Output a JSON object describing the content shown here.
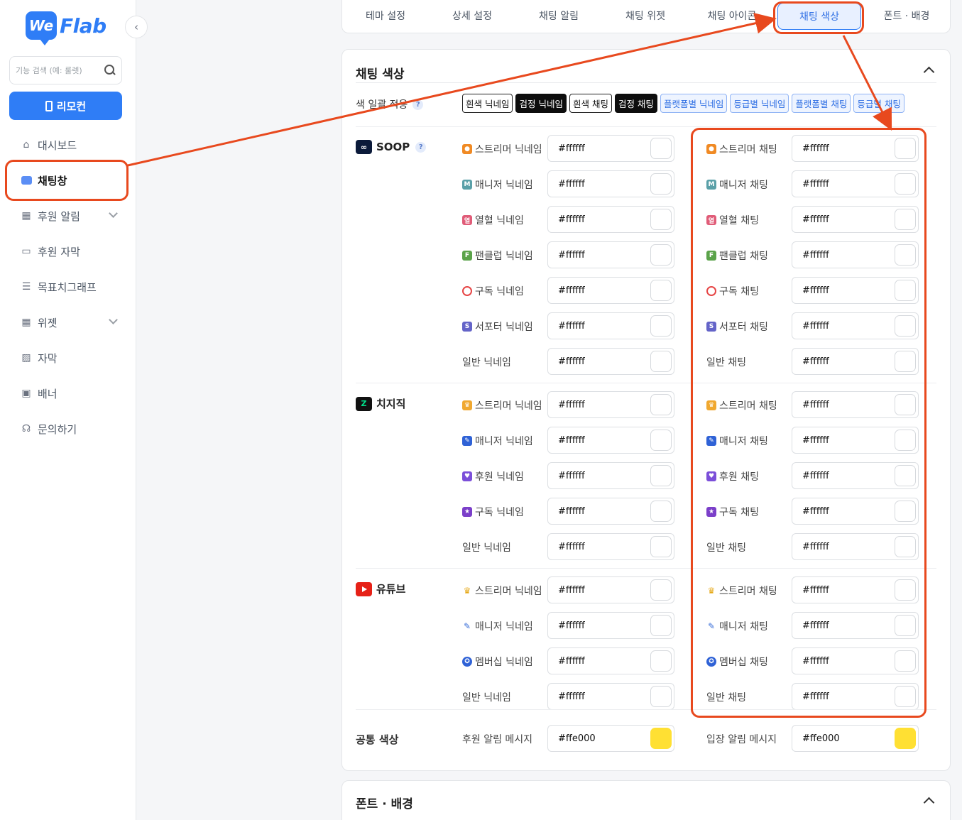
{
  "app": {
    "logo_badge": "We",
    "logo_text": "Flab"
  },
  "sidebar": {
    "search_placeholder": "기능 검색 (예: 룰렛)",
    "remote_label": "리모컨",
    "items": [
      {
        "label": "대시보드",
        "icon": "home-icon"
      },
      {
        "label": "채팅창",
        "icon": "chat-icon",
        "active": true
      },
      {
        "label": "후원 알림",
        "icon": "gift-icon",
        "expandable": true
      },
      {
        "label": "후원 자막",
        "icon": "caption-icon"
      },
      {
        "label": "목표치그래프",
        "icon": "graph-icon"
      },
      {
        "label": "위젯",
        "icon": "widget-icon",
        "expandable": true
      },
      {
        "label": "자막",
        "icon": "subtitle-icon"
      },
      {
        "label": "배너",
        "icon": "banner-icon"
      },
      {
        "label": "문의하기",
        "icon": "headset-icon"
      }
    ]
  },
  "tabs": [
    "테마 설정",
    "상세 설정",
    "채팅 알림",
    "채팅 위젯",
    "채팅 아이콘",
    "채팅 색상",
    "폰트 · 배경"
  ],
  "active_tab": "채팅 색상",
  "section": {
    "title": "채팅 색상",
    "bulk_label": "색 일괄 적용",
    "bulk_buttons": [
      {
        "label": "흰색 닉네임",
        "style": "white"
      },
      {
        "label": "검정 닉네임",
        "style": "black"
      },
      {
        "label": "흰색 채팅",
        "style": "white"
      },
      {
        "label": "검정 채팅",
        "style": "black"
      },
      {
        "label": "플랫폼별 닉네임",
        "style": "blue"
      },
      {
        "label": "등급별 닉네임",
        "style": "blue"
      },
      {
        "label": "플랫폼별 채팅",
        "style": "blue"
      },
      {
        "label": "등급별 채팅",
        "style": "blue"
      }
    ],
    "help_glyph": "?",
    "platforms": [
      {
        "name": "SOOP",
        "logo": "soop-logo",
        "help": true,
        "rows": [
          {
            "badge": "mic",
            "nick": "스트리머 닉네임",
            "chat": "스트리머 채팅",
            "nick_value": "#ffffff",
            "chat_value": "#ffffff"
          },
          {
            "badge": "m",
            "nick": "매니저 닉네임",
            "chat": "매니저 채팅",
            "nick_value": "#ffffff",
            "chat_value": "#ffffff"
          },
          {
            "badge": "yeol",
            "nick": "열혈 닉네임",
            "chat": "열혈 채팅",
            "nick_value": "#ffffff",
            "chat_value": "#ffffff"
          },
          {
            "badge": "f",
            "nick": "팬클럽 닉네임",
            "chat": "팬클럽 채팅",
            "nick_value": "#ffffff",
            "chat_value": "#ffffff"
          },
          {
            "badge": "sub",
            "nick": "구독 닉네임",
            "chat": "구독 채팅",
            "nick_value": "#ffffff",
            "chat_value": "#ffffff"
          },
          {
            "badge": "s",
            "nick": "서포터 닉네임",
            "chat": "서포터 채팅",
            "nick_value": "#ffffff",
            "chat_value": "#ffffff"
          },
          {
            "badge": "",
            "nick": "일반 닉네임",
            "chat": "일반 채팅",
            "nick_value": "#ffffff",
            "chat_value": "#ffffff"
          }
        ]
      },
      {
        "name": "치지직",
        "logo": "chzzk-logo",
        "help": false,
        "rows": [
          {
            "badge": "crown",
            "nick": "스트리머 닉네임",
            "chat": "스트리머 채팅",
            "nick_value": "#ffffff",
            "chat_value": "#ffffff"
          },
          {
            "badge": "wrench",
            "nick": "매니저 닉네임",
            "chat": "매니저 채팅",
            "nick_value": "#ffffff",
            "chat_value": "#ffffff"
          },
          {
            "badge": "heart",
            "nick": "후원 닉네임",
            "chat": "후원 채팅",
            "nick_value": "#ffffff",
            "chat_value": "#ffffff"
          },
          {
            "badge": "star",
            "nick": "구독 닉네임",
            "chat": "구독 채팅",
            "nick_value": "#ffffff",
            "chat_value": "#ffffff"
          },
          {
            "badge": "",
            "nick": "일반 닉네임",
            "chat": "일반 채팅",
            "nick_value": "#ffffff",
            "chat_value": "#ffffff"
          }
        ]
      },
      {
        "name": "유튜브",
        "logo": "youtube-logo",
        "help": false,
        "rows": [
          {
            "badge": "ytcrown",
            "nick": "스트리머 닉네임",
            "chat": "스트리머 채팅",
            "nick_value": "#ffffff",
            "chat_value": "#ffffff"
          },
          {
            "badge": "ytwrench",
            "nick": "매니저 닉네임",
            "chat": "매니저 채팅",
            "nick_value": "#ffffff",
            "chat_value": "#ffffff"
          },
          {
            "badge": "member",
            "nick": "멤버십 닉네임",
            "chat": "멤버십 채팅",
            "nick_value": "#ffffff",
            "chat_value": "#ffffff"
          },
          {
            "badge": "",
            "nick": "일반 닉네임",
            "chat": "일반 채팅",
            "nick_value": "#ffffff",
            "chat_value": "#ffffff"
          }
        ]
      }
    ],
    "common": {
      "label": "공통 색상",
      "left_label": "후원 알림 메시지",
      "left_value": "#ffe000",
      "right_label": "입장 알림 메시지",
      "right_value": "#ffe000"
    }
  },
  "section2": {
    "title": "폰트 · 배경"
  },
  "colors": {
    "accent": "#2f7df6",
    "annotation": "#e8491e",
    "swatch_yellow": "#ffe033"
  }
}
